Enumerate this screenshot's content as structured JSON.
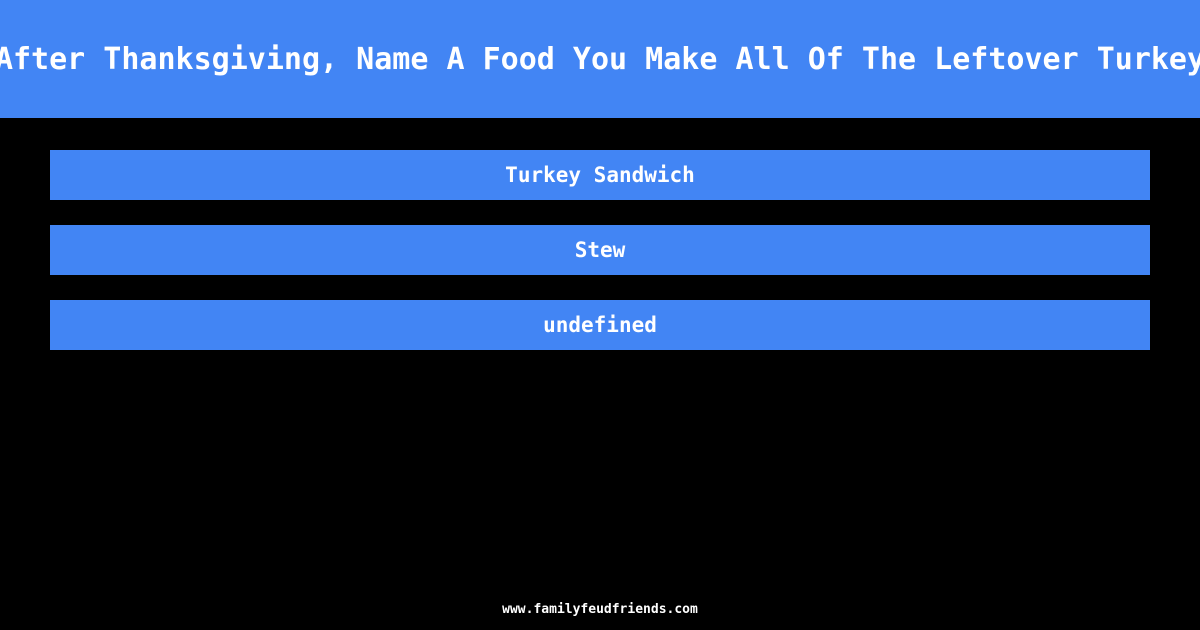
{
  "theme": {
    "background_color": "#000000",
    "accent_color": "#4285f4",
    "text_color": "#ffffff"
  },
  "header": {
    "title": "After Thanksgiving, Name A Food You Make All Of The Leftover Turkey"
  },
  "answers": [
    {
      "label": "Turkey Sandwich"
    },
    {
      "label": "Stew"
    },
    {
      "label": "undefined"
    }
  ],
  "footer": {
    "site": "www.familyfeudfriends.com"
  }
}
